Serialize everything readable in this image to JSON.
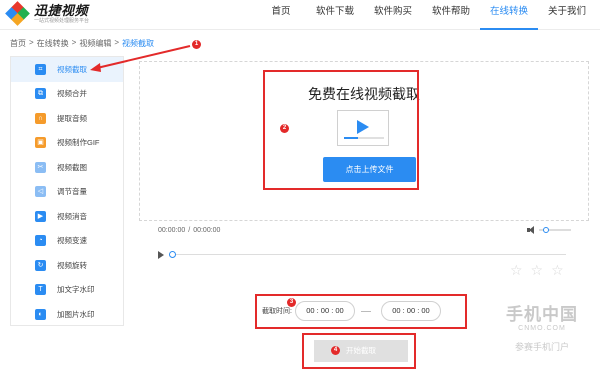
{
  "header": {
    "logo_title": "迅捷视频",
    "logo_subtitle": "一站式视频处理服务平台",
    "nav": [
      {
        "label": "首页"
      },
      {
        "label": "软件下载"
      },
      {
        "label": "软件购买"
      },
      {
        "label": "软件帮助"
      },
      {
        "label": "在线转换",
        "active": true
      },
      {
        "label": "关于我们"
      }
    ]
  },
  "breadcrumb": [
    "首页",
    "在线转换",
    "视频编辑",
    "视频截取"
  ],
  "breadcrumb_sep": ">",
  "sidebar": {
    "items": [
      {
        "label": "视频截取",
        "icon": "crop-icon",
        "active": true
      },
      {
        "label": "视频合并",
        "icon": "merge-icon"
      },
      {
        "label": "提取音频",
        "icon": "headphones-icon"
      },
      {
        "label": "视频制作GIF",
        "icon": "gif-icon"
      },
      {
        "label": "视频截图",
        "icon": "screenshot-icon"
      },
      {
        "label": "调节音量",
        "icon": "volume-icon"
      },
      {
        "label": "视频消音",
        "icon": "mute-icon"
      },
      {
        "label": "视频变速",
        "icon": "speed-icon"
      },
      {
        "label": "视频旋转",
        "icon": "rotate-icon"
      },
      {
        "label": "加文字水印",
        "icon": "text-watermark-icon"
      },
      {
        "label": "加图片水印",
        "icon": "image-watermark-icon"
      }
    ]
  },
  "upload": {
    "title": "免费在线视频截取",
    "button": "点击上传文件"
  },
  "player": {
    "current_time": "00:00:00",
    "separator": "/",
    "total_time": "00:00:00"
  },
  "crop": {
    "label": "截取时间:",
    "start": "00 : 00 : 00",
    "end": "00 : 00 : 00"
  },
  "start_button": "开始截取",
  "annotations": [
    "1",
    "2",
    "3",
    "4"
  ],
  "watermark": {
    "main": "手机中国",
    "url": "CNMO.COM",
    "sub": "参赛手机门户"
  },
  "colors": {
    "accent": "#2b8cf2",
    "annotation": "#e32a2a"
  }
}
